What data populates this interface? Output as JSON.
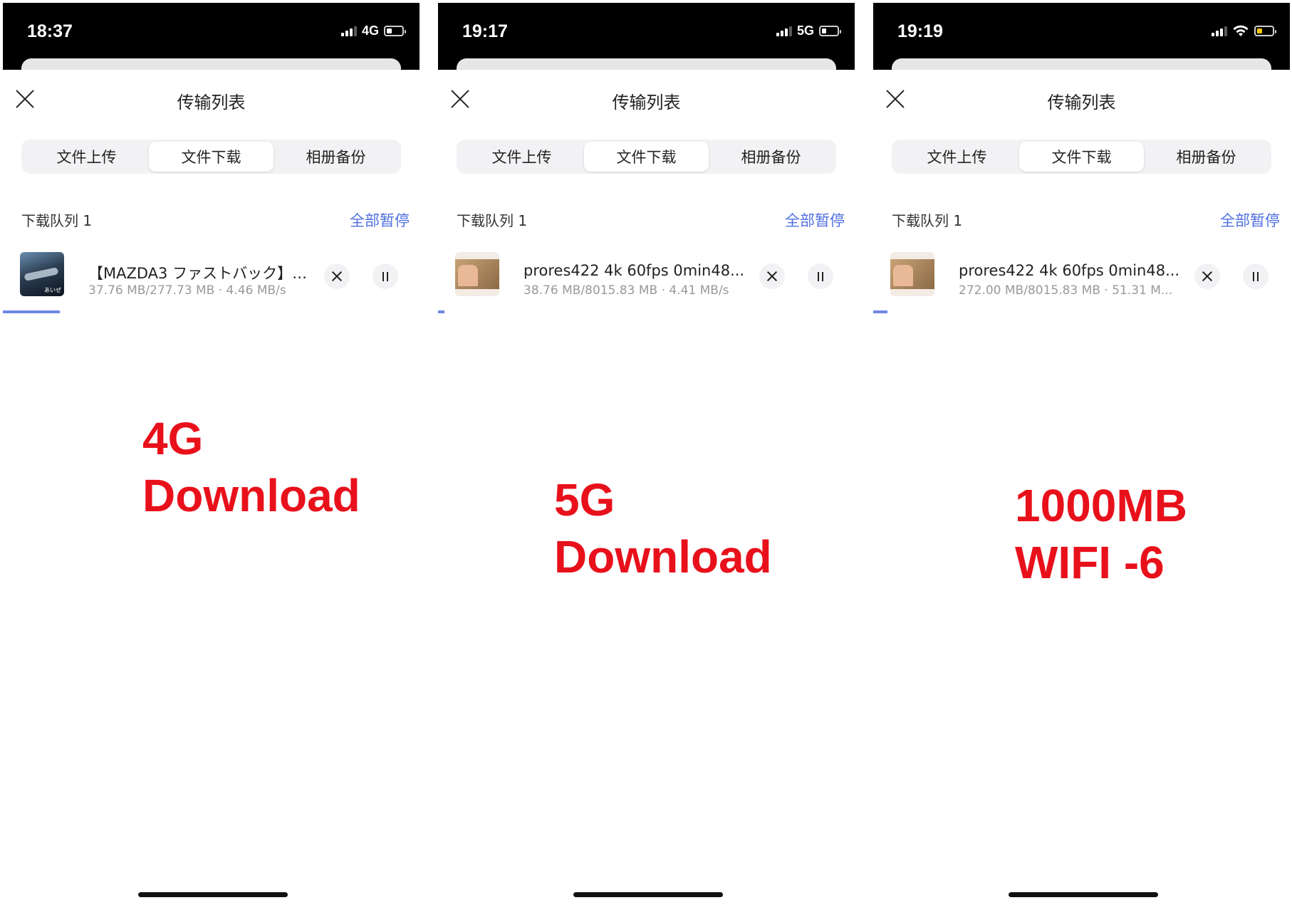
{
  "phones": [
    {
      "time": "18:37",
      "network": "4G",
      "battery_level": 0.3,
      "sheet_title": "传输列表",
      "tabs": [
        "文件上传",
        "文件下载",
        "相册备份"
      ],
      "active_tab": "文件下载",
      "queue_label": "下载队列 1",
      "pause_all": "全部暂停",
      "item": {
        "name": "【MAZDA3 ファストバック】…",
        "meta": "37.76 MB/277.73 MB · 4.46 MB/s",
        "progress": 0.136
      },
      "overlay": [
        "4G",
        "Download"
      ]
    },
    {
      "time": "19:17",
      "network": "5G",
      "battery_level": 0.25,
      "sheet_title": "传输列表",
      "tabs": [
        "文件上传",
        "文件下载",
        "相册备份"
      ],
      "active_tab": "文件下载",
      "queue_label": "下载队列 1",
      "pause_all": "全部暂停",
      "item": {
        "name": "prores422 4k 60fps 0min48...",
        "meta": "38.76 MB/8015.83 MB · 4.41 MB/s",
        "progress": 0.005
      },
      "overlay": [
        "5G",
        "Download"
      ]
    },
    {
      "time": "19:19",
      "network": "wifi",
      "battery_level": 0.3,
      "battery_color": "#f2c511",
      "sheet_title": "传输列表",
      "tabs": [
        "文件上传",
        "文件下载",
        "相册备份"
      ],
      "active_tab": "文件下载",
      "queue_label": "下载队列 1",
      "pause_all": "全部暂停",
      "item": {
        "name": "prores422 4k 60fps 0min48...",
        "meta": "272.00 MB/8015.83 MB · 51.31 M...",
        "progress": 0.034
      },
      "overlay": [
        "1000MB",
        "WIFI -6"
      ]
    }
  ],
  "colors": {
    "accent": "#4f6fe0",
    "progress": "#6f86e6",
    "overlay_red": "#e8111b"
  }
}
